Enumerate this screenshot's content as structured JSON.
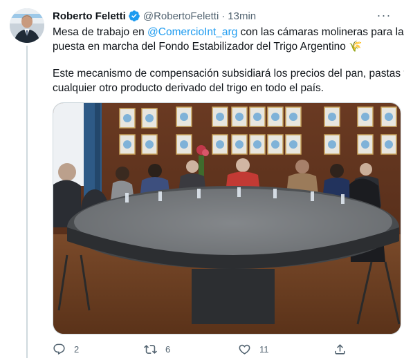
{
  "author": {
    "name": "Roberto Feletti",
    "handle": "@RobertoFeletti",
    "separator": "·",
    "time": "13min"
  },
  "tweet": {
    "line1_prefix": "Mesa de trabajo en ",
    "mention": "@ComercioInt_arg",
    "line1_suffix": "  con las cámaras molineras para la",
    "line2": "puesta en marcha del Fondo Estabilizador del Trigo Argentino",
    "emoji": "🌾",
    "para2_line1": "Este mecanismo de compensación subsidiará los precios del pan, pastas y",
    "para2_line2": "cualquier otro producto derivado del trigo en todo el país."
  },
  "more_label": "···",
  "actions": {
    "reply_count": "2",
    "retweet_count": "6",
    "like_count": "11"
  },
  "colors": {
    "accent": "#1d9bf0",
    "secondary_text": "#536471",
    "primary_text": "#0f1419"
  }
}
